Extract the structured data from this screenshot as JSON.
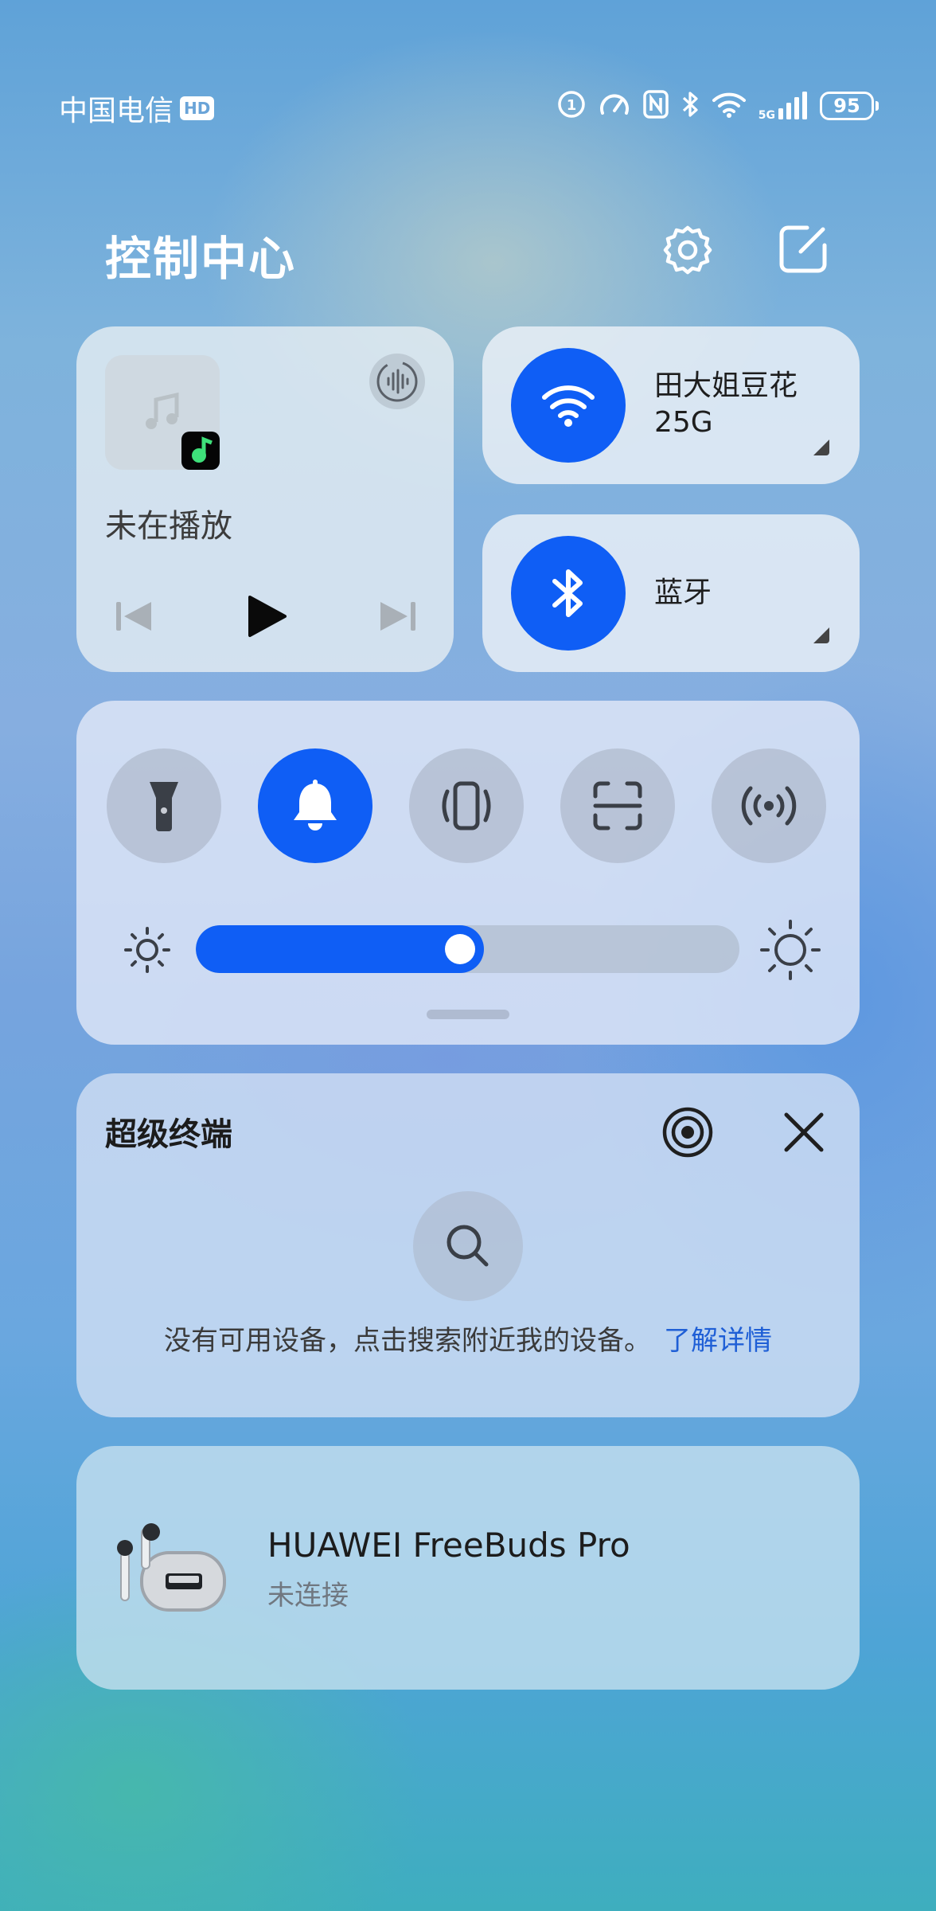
{
  "status_bar": {
    "carrier": "中国电信",
    "hd_badge": "HD",
    "network_type": "5G",
    "battery": "95"
  },
  "header": {
    "title": "控制中心"
  },
  "media": {
    "status": "未在播放"
  },
  "wifi": {
    "name": "田大姐豆花",
    "band": "25G"
  },
  "bluetooth": {
    "label": "蓝牙"
  },
  "quick_toggles": [
    {
      "name": "flashlight",
      "active": false
    },
    {
      "name": "ring",
      "active": true
    },
    {
      "name": "vibrate",
      "active": false
    },
    {
      "name": "scan",
      "active": false
    },
    {
      "name": "nfc",
      "active": false
    }
  ],
  "brightness": {
    "level": 0.53
  },
  "super_device": {
    "title": "超级终端",
    "hint": "没有可用设备，点击搜索附近我的设备。",
    "link": "了解详情"
  },
  "earbuds": {
    "name": "HUAWEI FreeBuds Pro",
    "status": "未连接"
  },
  "colors": {
    "accent": "#0f5ef5",
    "link": "#1f5fd6"
  }
}
